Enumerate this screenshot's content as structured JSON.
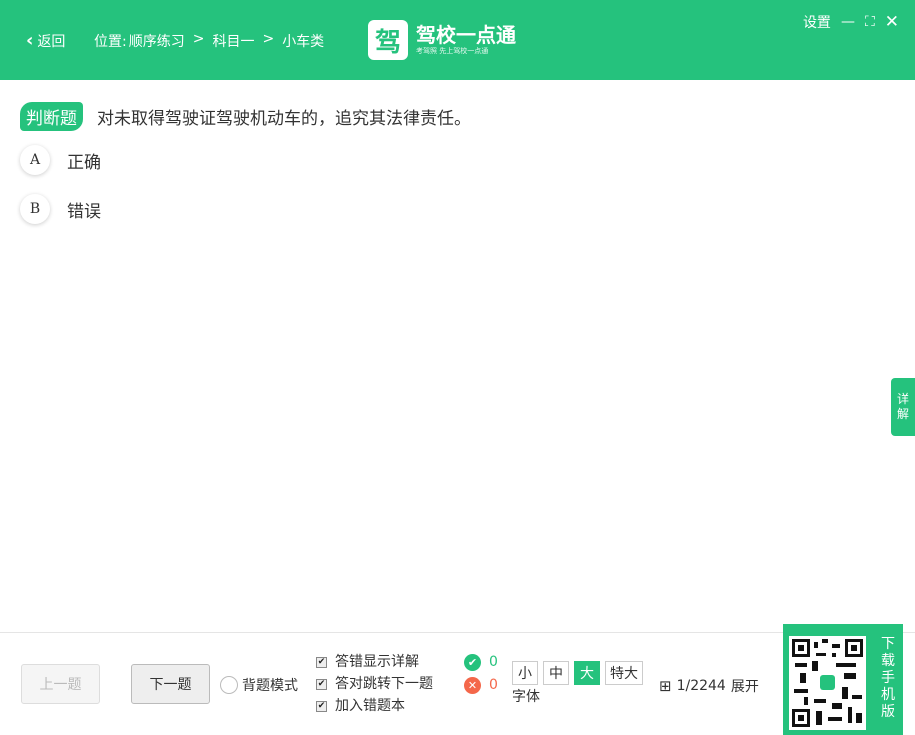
{
  "header": {
    "back": "返回",
    "location_label": "位置:",
    "crumbs": [
      "顺序练习",
      "科目一",
      "小车类"
    ],
    "sep": ">",
    "logo_glyph": "驾",
    "logo_title": "驾校一点通",
    "logo_sub": "考驾照 先上驾校一点通",
    "settings": "设置"
  },
  "question": {
    "type": "判断题",
    "text": "对未取得驾驶证驾驶机动车的，追究其法律责任。",
    "options": [
      {
        "key": "A",
        "text": "正确"
      },
      {
        "key": "B",
        "text": "错误"
      }
    ]
  },
  "detail_tab": [
    "详",
    "解"
  ],
  "footer": {
    "prev": "上一题",
    "next": "下一题",
    "recite_mode": "背题模式",
    "checks": [
      "答错显示详解",
      "答对跳转下一题",
      "加入错题本"
    ],
    "correct": "0",
    "wrong": "0",
    "font_sizes": [
      "小",
      "中",
      "大",
      "特大"
    ],
    "font_selected": "大",
    "font_label": "字体",
    "progress": "1/2244",
    "expand": "展开"
  },
  "download": [
    "下",
    "载",
    "手",
    "机",
    "版"
  ],
  "colors": {
    "accent": "#25c27d",
    "wrong": "#f4674a"
  }
}
